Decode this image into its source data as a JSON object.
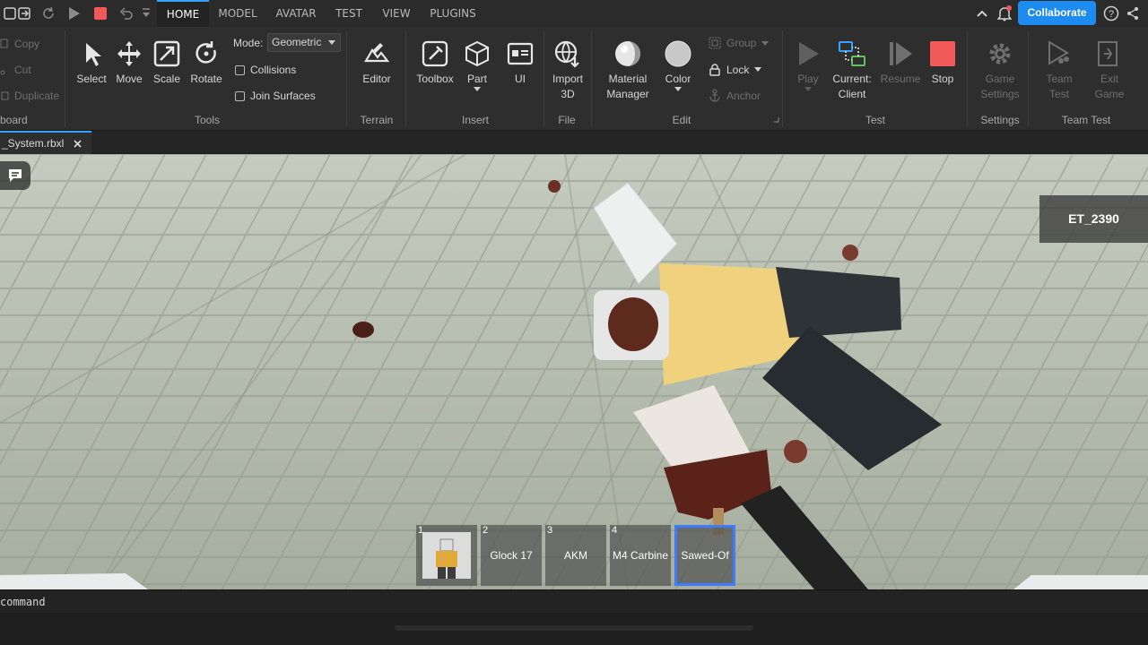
{
  "quick_access": {
    "icons": [
      "save-icon",
      "publish-icon",
      "redo-icon",
      "play-icon",
      "stop-icon",
      "undo-icon",
      "customize-icon"
    ]
  },
  "menu": {
    "tabs": [
      {
        "label": "HOME",
        "active": true
      },
      {
        "label": "MODEL",
        "active": false
      },
      {
        "label": "AVATAR",
        "active": false
      },
      {
        "label": "TEST",
        "active": false
      },
      {
        "label": "VIEW",
        "active": false
      },
      {
        "label": "PLUGINS",
        "active": false
      }
    ],
    "collaborate_label": "Collaborate"
  },
  "ribbon": {
    "clipboard": {
      "copy": "Copy",
      "cut": "Cut",
      "duplicate": "Duplicate",
      "group_label": "board"
    },
    "tools": {
      "select": "Select",
      "move": "Move",
      "scale": "Scale",
      "rotate": "Rotate",
      "mode_label": "Mode:",
      "mode_value": "Geometric",
      "collisions": "Collisions",
      "join_surfaces": "Join Surfaces",
      "group_label": "Tools"
    },
    "terrain": {
      "editor": "Editor",
      "group_label": "Terrain"
    },
    "insert": {
      "toolbox": "Toolbox",
      "part": "Part",
      "ui": "UI",
      "group_label": "Insert"
    },
    "file": {
      "import_line1": "Import",
      "import_line2": "3D",
      "group_label": "File"
    },
    "edit": {
      "material_line1": "Material",
      "material_line2": "Manager",
      "color": "Color",
      "group": "Group",
      "lock": "Lock",
      "anchor": "Anchor",
      "group_label": "Edit"
    },
    "test": {
      "play": "Play",
      "current_line1": "Current:",
      "current_line2": "Client",
      "resume": "Resume",
      "stop": "Stop",
      "group_label": "Test"
    },
    "settings": {
      "game_line1": "Game",
      "game_line2": "Settings",
      "group_label": "Settings"
    },
    "team_test": {
      "team_line1": "Team",
      "team_line2": "Test",
      "exit_line1": "Exit",
      "exit_line2": "Game",
      "group_label": "Team Test"
    }
  },
  "file_tab": {
    "name": "_System.rbxl"
  },
  "viewport": {
    "player_name": "ET_2390",
    "hotbar": [
      {
        "num": "1",
        "label": "",
        "selected": false,
        "has_avatar": true
      },
      {
        "num": "2",
        "label": "Glock 17",
        "selected": false
      },
      {
        "num": "3",
        "label": "AKM",
        "selected": false
      },
      {
        "num": "4",
        "label": "M4 Carbine",
        "selected": false
      },
      {
        "num": "",
        "label": "Sawed-Of",
        "selected": true
      }
    ]
  },
  "command": {
    "placeholder": "command"
  },
  "colors": {
    "accent": "#1d8cf0",
    "selected_slot": "#3d7cff",
    "stop_red": "#f25a5a",
    "ground": "#b3bbad"
  }
}
